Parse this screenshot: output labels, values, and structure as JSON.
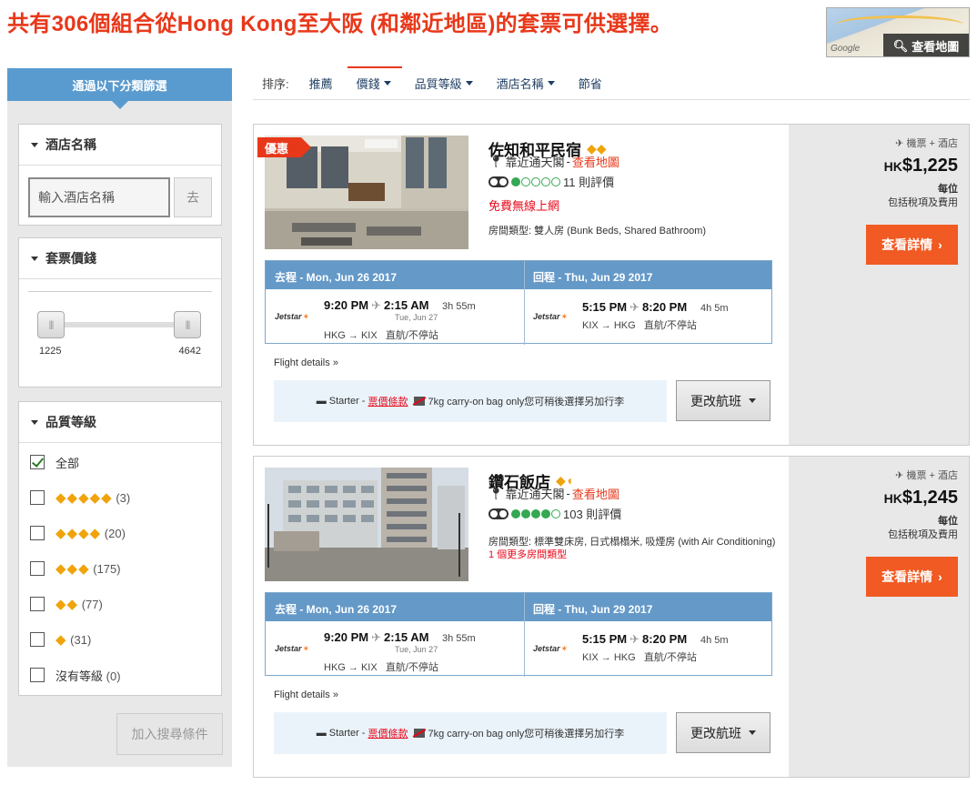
{
  "headline": "共有306個組合從Hong Kong至大阪 (和鄰近地區)的套票可供選擇。",
  "map": {
    "button_label": "查看地圖",
    "logo": "Google"
  },
  "sidebar": {
    "header": "通過以下分類篩選",
    "hotel_name": {
      "title": "酒店名稱",
      "placeholder": "輸入酒店名稱",
      "go_label": "去"
    },
    "price": {
      "title": "套票價錢",
      "min": "1225",
      "max": "4642"
    },
    "star_rating": {
      "title": "品質等級",
      "options": [
        {
          "label": "全部",
          "diamonds": "",
          "count": "",
          "checked": true
        },
        {
          "label": "",
          "diamonds": "◆◆◆◆◆",
          "count": "(3)",
          "checked": false
        },
        {
          "label": "",
          "diamonds": "◆◆◆◆",
          "count": "(20)",
          "checked": false
        },
        {
          "label": "",
          "diamonds": "◆◆◆",
          "count": "(175)",
          "checked": false
        },
        {
          "label": "",
          "diamonds": "◆◆",
          "count": "(77)",
          "checked": false
        },
        {
          "label": "",
          "diamonds": "◆",
          "count": "(31)",
          "checked": false
        },
        {
          "label": "沒有等級",
          "diamonds": "",
          "count": "(0)",
          "checked": false
        }
      ]
    },
    "add_button": "加入搜尋條件"
  },
  "sort": {
    "label": "排序:",
    "options": [
      "推薦",
      "價錢",
      "品質等級",
      "酒店名稱",
      "節省"
    ],
    "active": "價錢"
  },
  "results": [
    {
      "badge": "優惠",
      "name": "佐知和平民宿",
      "diamonds": "◆◆",
      "location": "靠近通天閣",
      "map_link": "查看地圖",
      "review_count": "11 則評價",
      "rating_dots": 1,
      "wifi": "免費無線上網",
      "room_type": "房間類型: 雙人房 (Bunk Beds, Shared Bathroom)",
      "more_rooms": "",
      "outbound": {
        "header": "去程 - Mon, Jun 26 2017",
        "airline": "Jetstar",
        "depart": "9:20 PM",
        "arrive": "2:15 AM",
        "duration": "3h 55m",
        "arrive_date": "Tue, Jun 27",
        "route": "HKG → KIX",
        "stops": "直航/不停站"
      },
      "inbound": {
        "header": "回程 - Thu, Jun 29 2017",
        "airline": "Jetstar",
        "depart": "5:15 PM",
        "arrive": "8:20 PM",
        "duration": "4h 5m",
        "route": "KIX → HKG",
        "stops": "直航/不停站"
      },
      "flight_details": "Flight details",
      "fare_name": "Starter -",
      "fare_link": "票價條款",
      "baggage": "7kg carry-on bag only您可稍後選擇另加行李",
      "change_flight": "更改航班",
      "package_label": "機票 + 酒店",
      "currency": "HK",
      "price": "$1,225",
      "per": "每位",
      "tax": "包括稅項及費用",
      "detail_button": "查看詳情"
    },
    {
      "badge": "",
      "name": "鑽石飯店",
      "diamonds": "◆◖",
      "location": "靠近通天閣",
      "map_link": "查看地圖",
      "review_count": "103 則評價",
      "rating_dots": 4,
      "wifi": "",
      "room_type": "房間類型: 標準雙床房, 日式榻榻米, 吸煙房 (with Air Conditioning)",
      "more_rooms": "1 個更多房間類型",
      "outbound": {
        "header": "去程 - Mon, Jun 26 2017",
        "airline": "Jetstar",
        "depart": "9:20 PM",
        "arrive": "2:15 AM",
        "duration": "3h 55m",
        "arrive_date": "Tue, Jun 27",
        "route": "HKG → KIX",
        "stops": "直航/不停站"
      },
      "inbound": {
        "header": "回程 - Thu, Jun 29 2017",
        "airline": "Jetstar",
        "depart": "5:15 PM",
        "arrive": "8:20 PM",
        "duration": "4h 5m",
        "route": "KIX → HKG",
        "stops": "直航/不停站"
      },
      "flight_details": "Flight details",
      "fare_name": "Starter -",
      "fare_link": "票價條款",
      "baggage": "7kg carry-on bag only您可稍後選擇另加行李",
      "change_flight": "更改航班",
      "package_label": "機票 + 酒店",
      "currency": "HK",
      "price": "$1,245",
      "per": "每位",
      "tax": "包括稅項及費用",
      "detail_button": "查看詳情"
    }
  ]
}
